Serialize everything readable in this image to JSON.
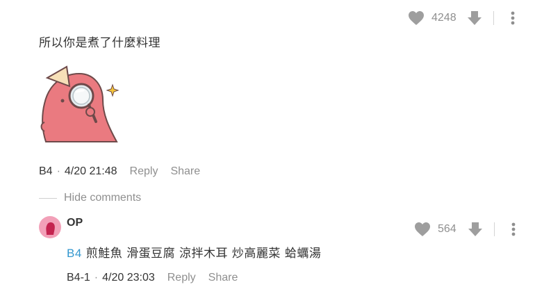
{
  "comment": {
    "likes": "4248",
    "text": "所以你是煮了什麼料理",
    "sticker": "pink-creature-magnifying-glass",
    "floor": "B4",
    "timestamp": "4/20 21:48",
    "reply_label": "Reply",
    "share_label": "Share"
  },
  "replies_toggle": {
    "label": "Hide comments"
  },
  "reply": {
    "author": "OP",
    "likes": "564",
    "mention": "B4",
    "text": "煎鮭魚 滑蛋豆腐 涼拌木耳 炒高麗菜 蛤蠣湯",
    "floor": "B4-1",
    "timestamp": "4/20 23:03",
    "reply_label": "Reply",
    "share_label": "Share"
  },
  "colors": {
    "text": "#333333",
    "muted": "#8f8f8f",
    "link": "#3397cf",
    "icon": "#9e9e9e",
    "avatar_bg": "#f2a0b8",
    "sticker_body": "#ea7a80"
  },
  "icons": [
    "heart-icon",
    "thumbs-down-arrow-icon",
    "more-vertical-icon"
  ]
}
